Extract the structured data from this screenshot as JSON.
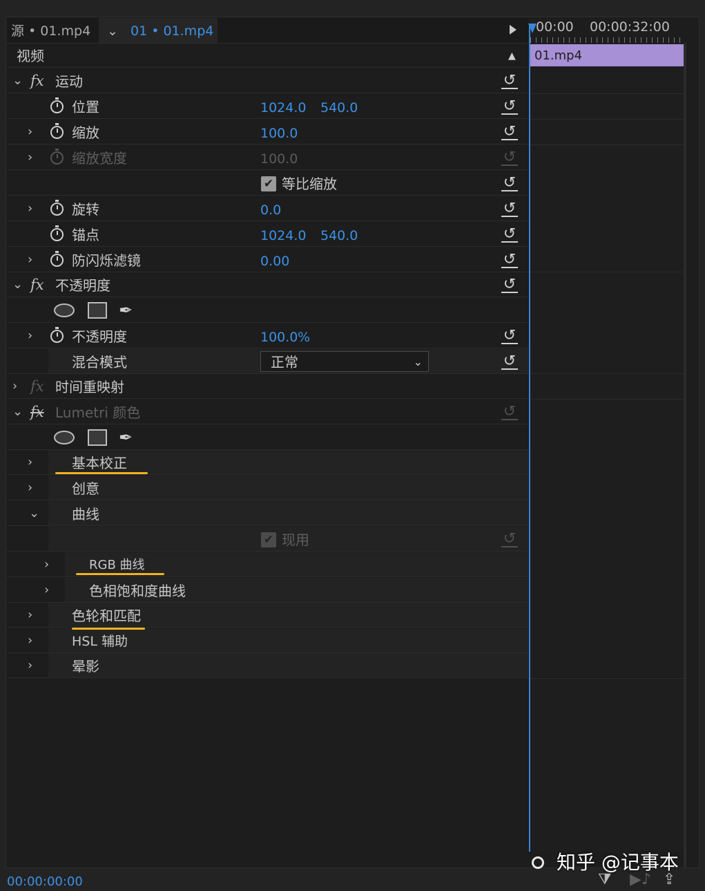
{
  "tabs": {
    "source_tab": "源 • 01.mp4",
    "active_tab": "01 • 01.mp4"
  },
  "section_video": "视频",
  "motion": {
    "label": "运动",
    "position": {
      "label": "位置",
      "x": "1024.0",
      "y": "540.0"
    },
    "scale": {
      "label": "缩放",
      "value": "100.0"
    },
    "scale_width": {
      "label": "缩放宽度",
      "value": "100.0"
    },
    "uniform_scale": {
      "label": "等比缩放",
      "checked": true
    },
    "rotation": {
      "label": "旋转",
      "value": "0.0"
    },
    "anchor": {
      "label": "锚点",
      "x": "1024.0",
      "y": "540.0"
    },
    "anti_flicker": {
      "label": "防闪烁滤镜",
      "value": "0.00"
    }
  },
  "opacity": {
    "label": "不透明度",
    "value_label": "不透明度",
    "value": "100.0",
    "unit": "%",
    "blend_label": "混合模式",
    "blend_value": "正常"
  },
  "time_remap": {
    "label": "时间重映射"
  },
  "lumetri": {
    "label": "Lumetri 颜色",
    "basic": "基本校正",
    "creative": "创意",
    "curves": "曲线",
    "curves_enable": "现用",
    "rgb_curves": "RGB 曲线",
    "hue_sat_curves": "色相饱和度曲线",
    "color_wheels": "色轮和匹配",
    "hsl": "HSL 辅助",
    "vignette": "晕影"
  },
  "timeline": {
    "time_start": "00:00",
    "time_mark": "00:00:32:00",
    "clip_name": "01.mp4"
  },
  "footer": {
    "timecode": "00:00:00:00"
  },
  "watermark": "知乎 @记事本",
  "colors": {
    "accent_blue": "#3d91e6",
    "clip_purple": "#a790d6",
    "highlight_underline": "#f0b21e",
    "panel_bg": "#1d1d1d"
  },
  "icons": {
    "stopwatch": "stopwatch-icon",
    "reset": "reset-icon",
    "fx": "fx-icon",
    "pen": "pen-mask-icon",
    "filter": "filter-icon",
    "export": "export-icon"
  }
}
